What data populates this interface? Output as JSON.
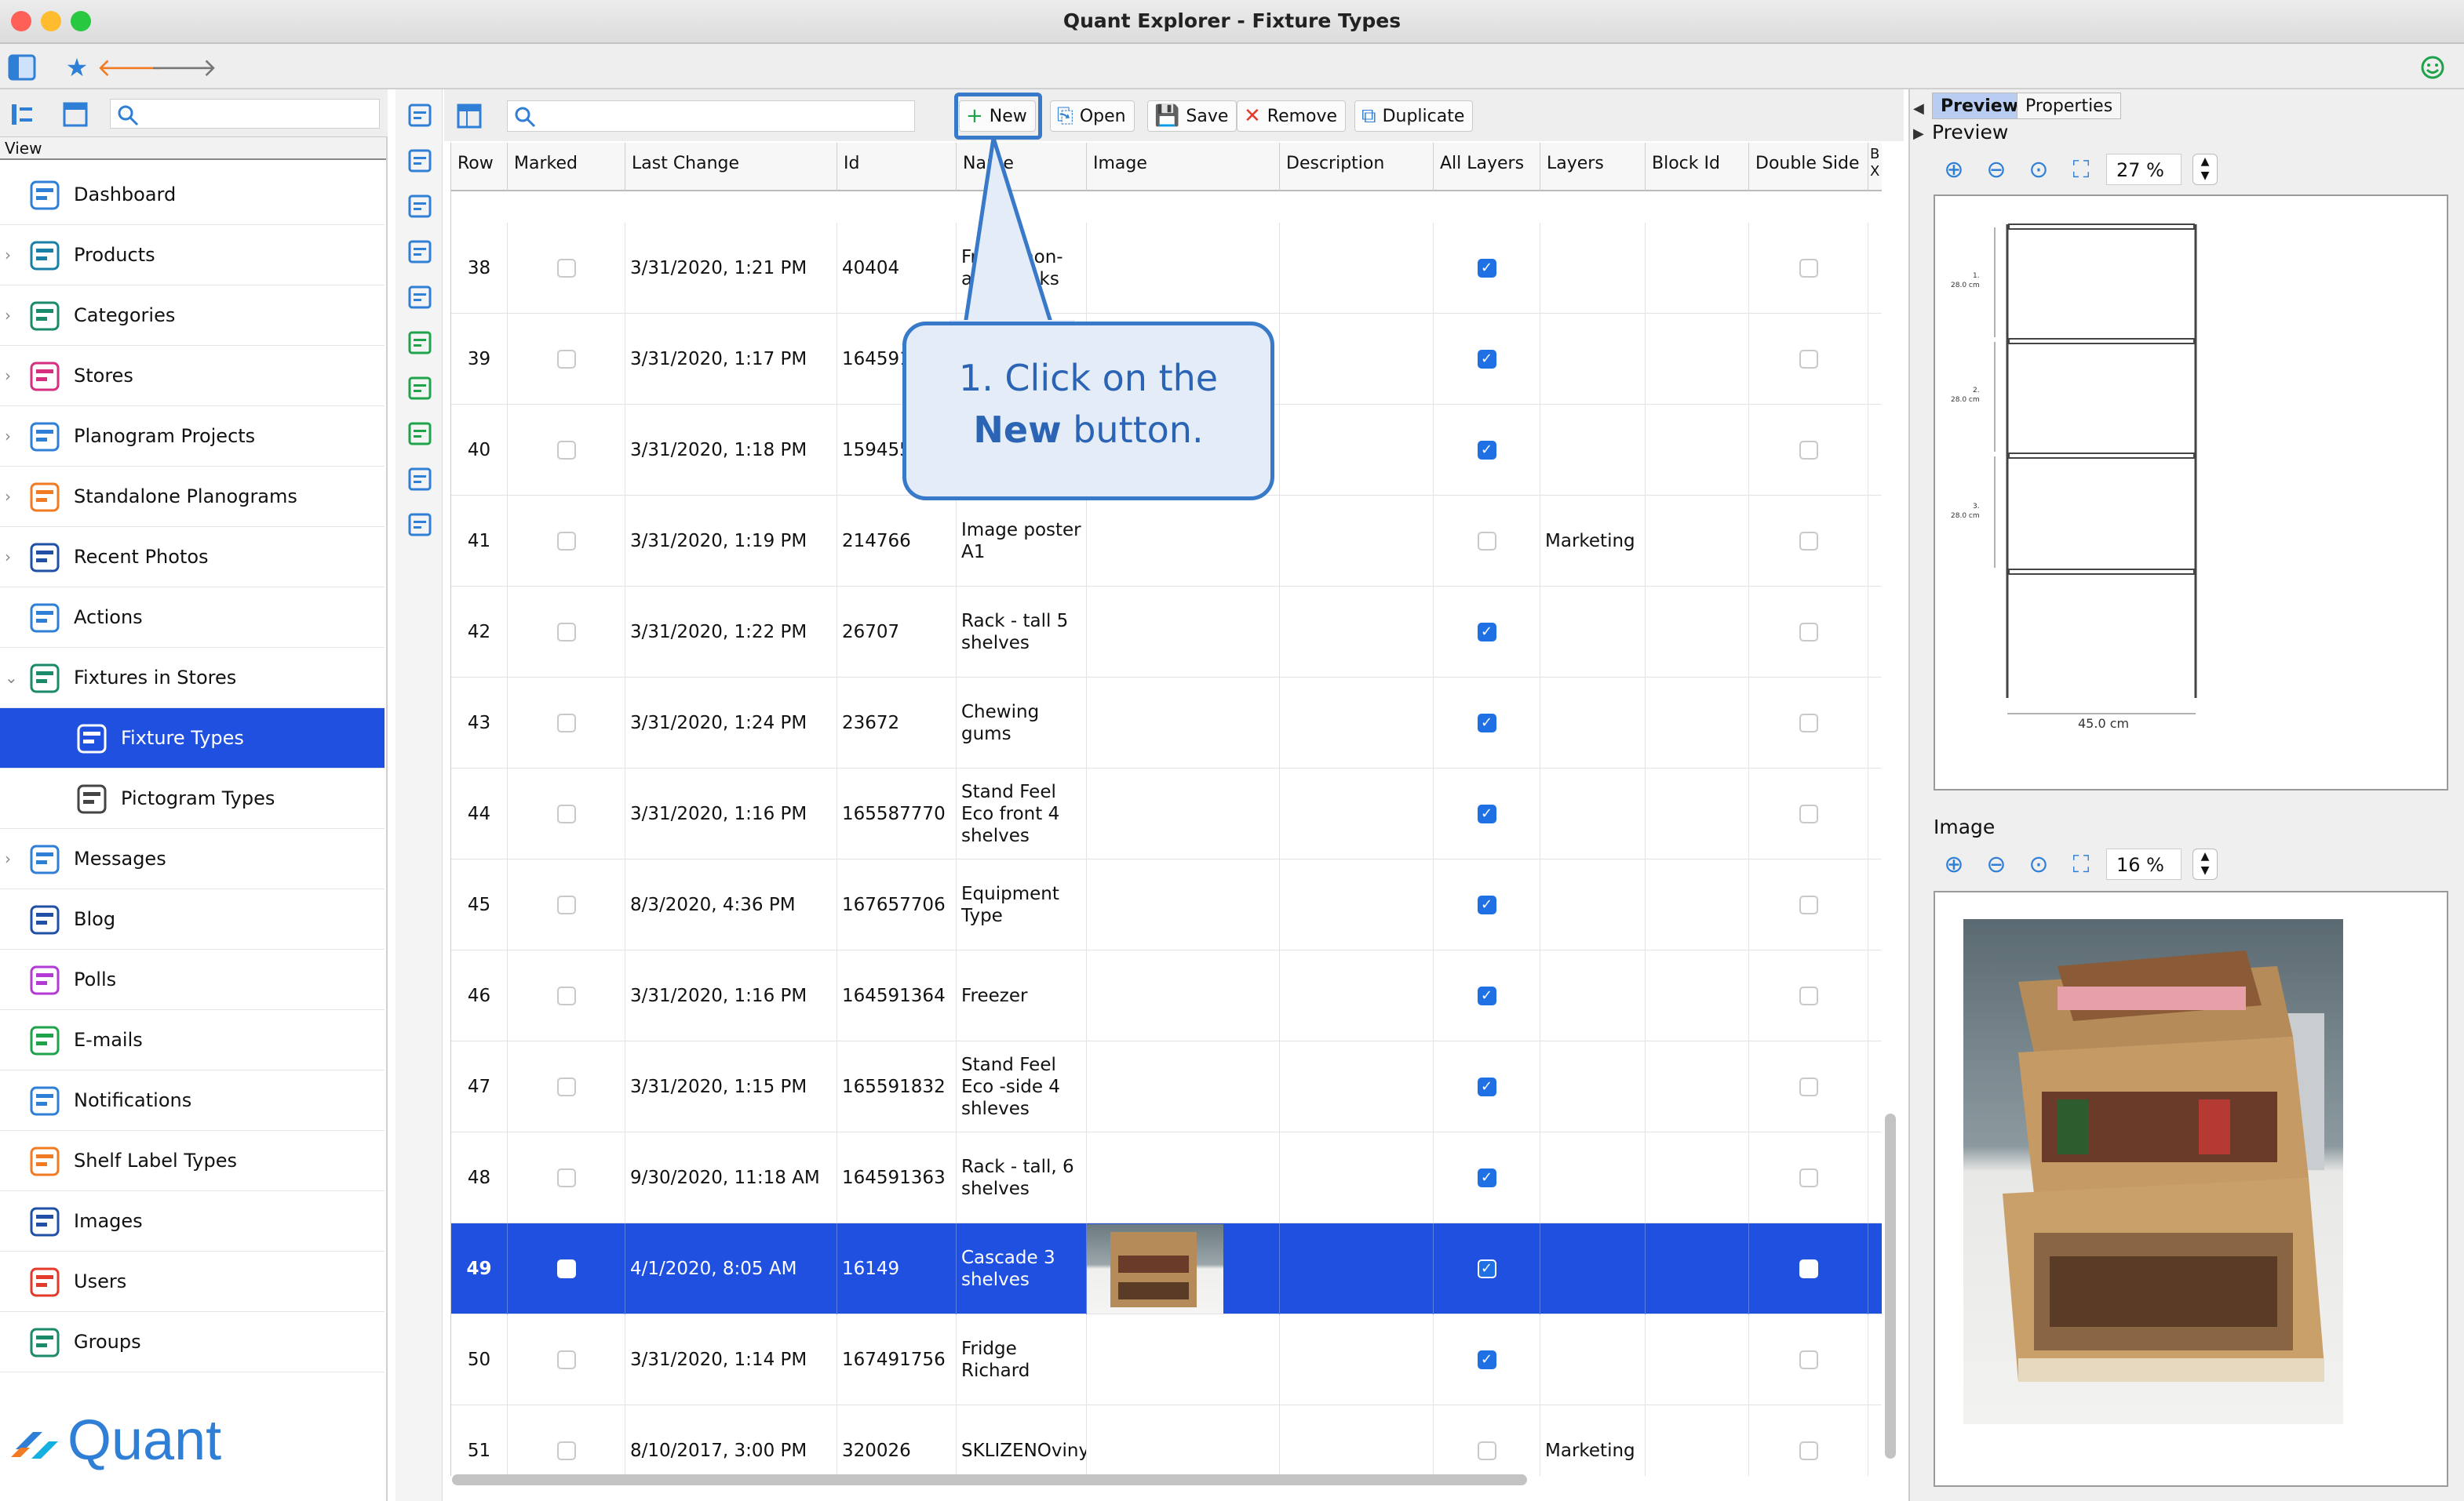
{
  "window": {
    "title": "Quant Explorer - Fixture Types"
  },
  "sidebar": {
    "view_label": "View",
    "items": [
      {
        "label": "Dashboard",
        "icon": "dashboard-icon",
        "expandable": false
      },
      {
        "label": "Products",
        "icon": "products-icon",
        "expandable": true
      },
      {
        "label": "Categories",
        "icon": "categories-icon",
        "expandable": true
      },
      {
        "label": "Stores",
        "icon": "stores-icon",
        "expandable": true
      },
      {
        "label": "Planogram Projects",
        "icon": "planogram-projects-icon",
        "expandable": true
      },
      {
        "label": "Standalone Planograms",
        "icon": "standalone-planograms-icon",
        "expandable": true
      },
      {
        "label": "Recent Photos",
        "icon": "camera-icon",
        "expandable": true
      },
      {
        "label": "Actions",
        "icon": "actions-icon",
        "expandable": false
      },
      {
        "label": "Fixtures in Stores",
        "icon": "fixtures-icon",
        "expandable": true,
        "expanded": true
      },
      {
        "label": "Fixture Types",
        "icon": "fixture-types-icon",
        "selected": true,
        "child": true
      },
      {
        "label": "Pictogram Types",
        "icon": "pictogram-icon",
        "child": true
      },
      {
        "label": "Messages",
        "icon": "messages-icon",
        "expandable": true
      },
      {
        "label": "Blog",
        "icon": "blog-icon",
        "expandable": false
      },
      {
        "label": "Polls",
        "icon": "polls-icon",
        "expandable": false
      },
      {
        "label": "E-mails",
        "icon": "email-icon",
        "expandable": false
      },
      {
        "label": "Notifications",
        "icon": "bell-icon",
        "expandable": false
      },
      {
        "label": "Shelf Label Types",
        "icon": "shelf-label-icon",
        "expandable": false
      },
      {
        "label": "Images",
        "icon": "image-icon",
        "expandable": false
      },
      {
        "label": "Users",
        "icon": "user-icon",
        "expandable": false
      },
      {
        "label": "Groups",
        "icon": "groups-icon",
        "expandable": false
      }
    ],
    "brand": "Quant"
  },
  "toolbar": {
    "new_label": "New",
    "open_label": "Open",
    "save_label": "Save",
    "remove_label": "Remove",
    "duplicate_label": "Duplicate"
  },
  "table": {
    "columns": [
      "Row",
      "Marked",
      "Last Change",
      "Id",
      "Name",
      "Image",
      "Description",
      "All Layers",
      "Layers",
      "Block Id",
      "Double Side",
      "B X"
    ],
    "rows": [
      {
        "row": "38",
        "marked": false,
        "last_change": "3/31/2020, 1:21 PM",
        "id": "40404",
        "name": "Fridge non-alco drinks",
        "all_layers": true,
        "layers": "",
        "selected": false
      },
      {
        "row": "39",
        "marked": false,
        "last_change": "3/31/2020, 1:17 PM",
        "id": "164591",
        "name": "",
        "all_layers": true,
        "layers": "",
        "selected": false
      },
      {
        "row": "40",
        "marked": false,
        "last_change": "3/31/2020, 1:18 PM",
        "id": "159455",
        "name": "",
        "all_layers": true,
        "layers": "",
        "selected": false
      },
      {
        "row": "41",
        "marked": false,
        "last_change": "3/31/2020, 1:19 PM",
        "id": "214766",
        "name": "Image poster A1",
        "all_layers": false,
        "layers": "Marketing",
        "selected": false
      },
      {
        "row": "42",
        "marked": false,
        "last_change": "3/31/2020, 1:22 PM",
        "id": "26707",
        "name": "Rack - tall 5 shelves",
        "all_layers": true,
        "layers": "",
        "selected": false
      },
      {
        "row": "43",
        "marked": false,
        "last_change": "3/31/2020, 1:24 PM",
        "id": "23672",
        "name": "Chewing gums",
        "all_layers": true,
        "layers": "",
        "selected": false
      },
      {
        "row": "44",
        "marked": false,
        "last_change": "3/31/2020, 1:16 PM",
        "id": "165587770",
        "name": "Stand Feel Eco front 4 shelves",
        "all_layers": true,
        "layers": "",
        "selected": false
      },
      {
        "row": "45",
        "marked": false,
        "last_change": "8/3/2020, 4:36 PM",
        "id": "167657706",
        "name": "Equipment Type",
        "all_layers": true,
        "layers": "",
        "selected": false
      },
      {
        "row": "46",
        "marked": false,
        "last_change": "3/31/2020, 1:16 PM",
        "id": "164591364",
        "name": "Freezer",
        "all_layers": true,
        "layers": "",
        "selected": false
      },
      {
        "row": "47",
        "marked": false,
        "last_change": "3/31/2020, 1:15 PM",
        "id": "165591832",
        "name": "Stand Feel Eco -side 4 shleves",
        "all_layers": true,
        "layers": "",
        "selected": false
      },
      {
        "row": "48",
        "marked": false,
        "last_change": "9/30/2020, 11:18 AM",
        "id": "164591363",
        "name": "Rack - tall, 6 shelves",
        "all_layers": true,
        "layers": "",
        "selected": false
      },
      {
        "row": "49",
        "marked": false,
        "last_change": "4/1/2020, 8:05 AM",
        "id": "16149",
        "name": "Cascade 3 shelves",
        "all_layers": true,
        "layers": "",
        "selected": true,
        "has_image": true
      },
      {
        "row": "50",
        "marked": false,
        "last_change": "3/31/2020, 1:14 PM",
        "id": "167491756",
        "name": "Fridge Richard",
        "all_layers": true,
        "layers": "",
        "selected": false
      },
      {
        "row": "51",
        "marked": false,
        "last_change": "8/10/2017, 3:00 PM",
        "id": "320026",
        "name": "SKLIZENOviny",
        "all_layers": false,
        "layers": "Marketing",
        "selected": false
      }
    ]
  },
  "right_panel": {
    "tabs": [
      "Preview",
      "Properties"
    ],
    "preview_label": "Preview",
    "preview_zoom": "27 %",
    "image_label": "Image",
    "image_zoom": "16 %",
    "drawing": {
      "shelf_labels": [
        "1.",
        "28.0 cm",
        "2.",
        "28.0 cm",
        "3.",
        "28.0 cm"
      ],
      "width_label": "45.0 cm"
    }
  },
  "callout": {
    "line1": "1. Click on the",
    "bold": "New",
    "line2_rest": " button."
  },
  "colors": {
    "accent": "#1f50e0",
    "callout_border": "#3879c9",
    "callout_fill": "#e3ecf7"
  }
}
